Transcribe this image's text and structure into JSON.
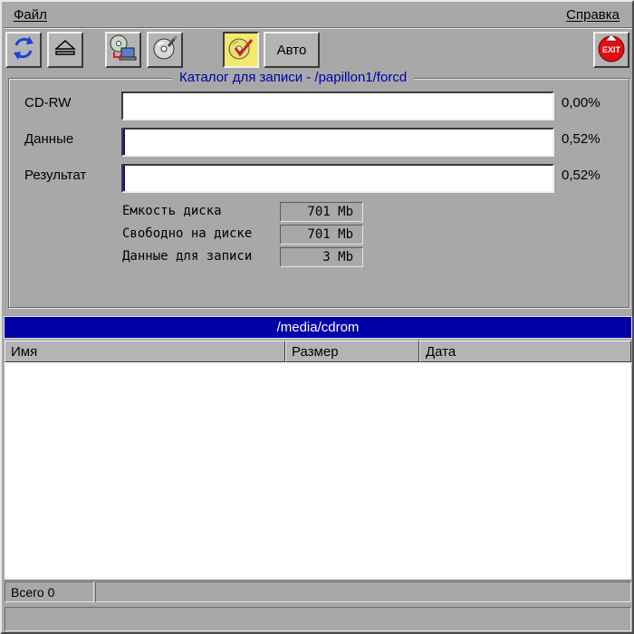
{
  "menu": {
    "file": "Файл",
    "help": "Справка"
  },
  "toolbar": {
    "auto_label": "Авто",
    "icons": [
      "refresh-icon",
      "eject-icon",
      "copy-to-cd-icon",
      "cd-erase-icon",
      "burn-cd-icon",
      "exit-icon"
    ],
    "exit_text": "EXIT"
  },
  "catalog": {
    "title": "Каталог для записи - /papillon1/forcd",
    "rows": [
      {
        "label": "CD-RW",
        "percent_text": "0,00%",
        "fraction": 0.0
      },
      {
        "label": "Данные",
        "percent_text": "0,52%",
        "fraction": 0.0052
      },
      {
        "label": "Результат",
        "percent_text": "0,52%",
        "fraction": 0.0052
      }
    ],
    "info": [
      {
        "label": "Емкость диска",
        "value": "701 Mb"
      },
      {
        "label": "Свободно на диске",
        "value": "701 Mb"
      },
      {
        "label": "Данные для записи",
        "value": "3 Mb"
      }
    ]
  },
  "file_panel": {
    "path": "/media/cdrom",
    "columns": [
      "Имя",
      "Размер",
      "Дата"
    ],
    "rows": []
  },
  "status": {
    "total": "Всего 0",
    "message": ""
  },
  "colors": {
    "title_bar": "#0000a8",
    "accent_text": "#0000a8",
    "active_button": "#f4e86e",
    "progress_fill": "#10108c"
  }
}
